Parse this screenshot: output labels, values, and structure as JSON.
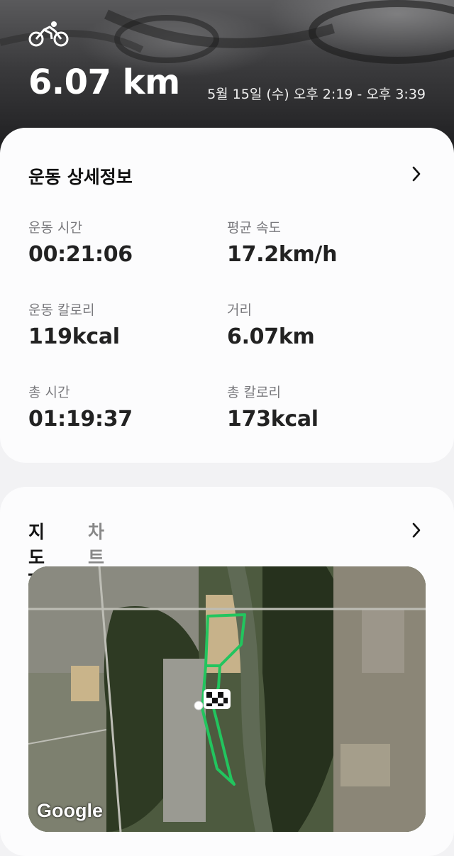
{
  "header": {
    "activity_icon": "cycling-icon",
    "distance": "6.07 km",
    "datetime": "5월 15일 (수) 오후 2:19 - 오후 3:39"
  },
  "details": {
    "title": "운동 상세정보",
    "stats": [
      {
        "label": "운동 시간",
        "value": "00:21:06"
      },
      {
        "label": "평균 속도",
        "value": "17.2km/h"
      },
      {
        "label": "운동 칼로리",
        "value": "119kcal"
      },
      {
        "label": "거리",
        "value": "6.07km"
      },
      {
        "label": "총 시간",
        "value": "01:19:37"
      },
      {
        "label": "총 칼로리",
        "value": "173kcal"
      }
    ]
  },
  "map_section": {
    "tabs": [
      "지도",
      "차트"
    ],
    "active_tab": "지도",
    "map_attribution": "Google",
    "route_color": "#22c55e"
  }
}
